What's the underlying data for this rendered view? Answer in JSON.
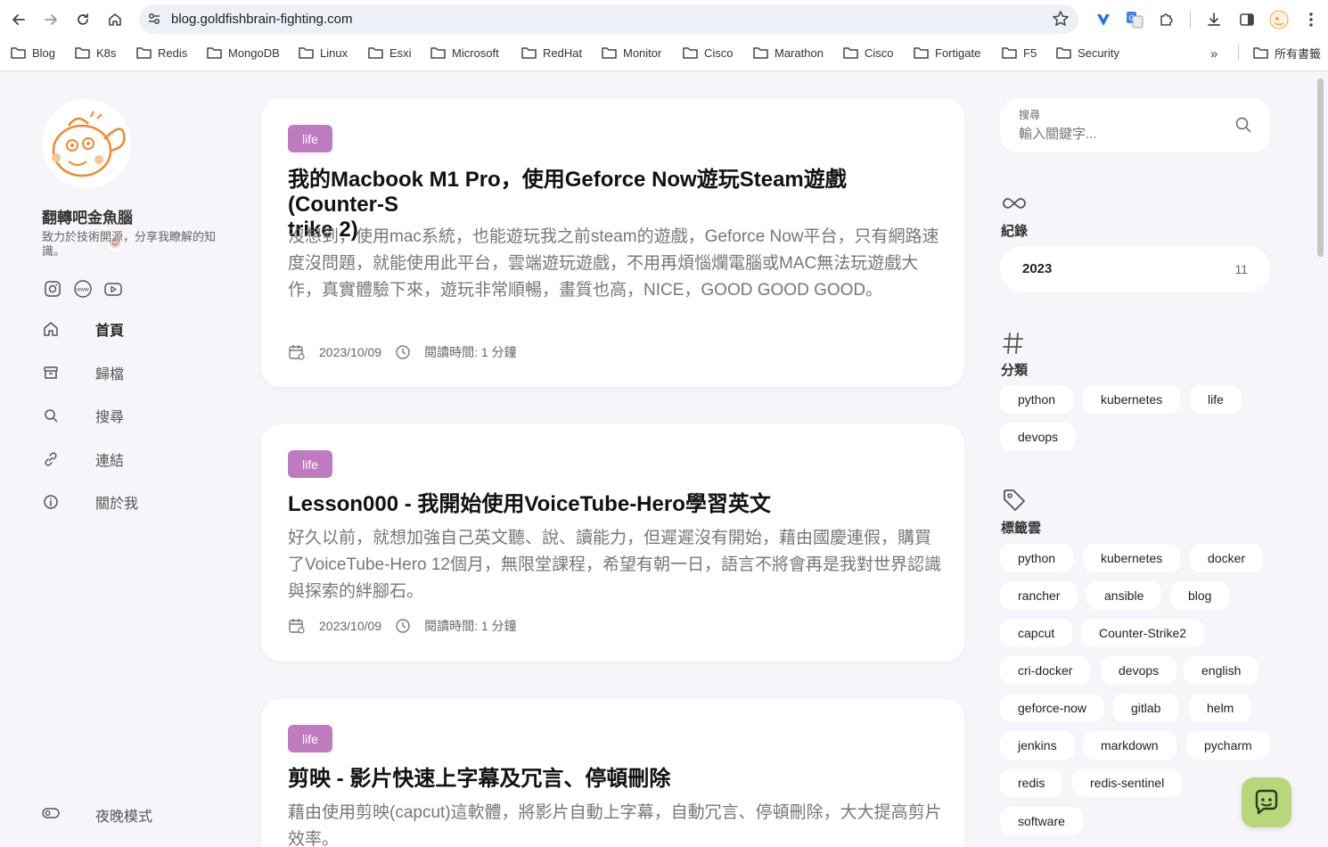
{
  "browser": {
    "url": "blog.goldfishbrain-fighting.com",
    "bookmarks": [
      "Blog",
      "K8s",
      "Redis",
      "MongoDB",
      "Linux",
      "Esxi",
      "Microsoft",
      "RedHat",
      "Monitor",
      "Cisco",
      "Marathon",
      "Cisco",
      "Fortigate",
      "F5",
      "Security"
    ],
    "all_bookmarks": "所有書籤",
    "more": "»"
  },
  "sidebar": {
    "site_title": "翻轉吧金魚腦",
    "site_desc": "致力於技術開源，分享我瞭解的知識。",
    "menu": [
      {
        "label": "首頁",
        "icon": "home-icon"
      },
      {
        "label": "歸檔",
        "icon": "archive-icon"
      },
      {
        "label": "搜尋",
        "icon": "search-icon"
      },
      {
        "label": "連結",
        "icon": "link-icon"
      },
      {
        "label": "關於我",
        "icon": "info-icon"
      }
    ],
    "night_mode": "夜晚模式"
  },
  "posts": [
    {
      "category": "life",
      "title": "我的Macbook M1 Pro，使用Geforce Now遊玩Steam遊戲(Counter-Strike 2)",
      "title_line1": "我的Macbook M1 Pro，使用Geforce Now遊玩Steam遊戲(Counter-S",
      "title_line2": "trike 2)",
      "excerpt": "沒想到，使用mac系統，也能遊玩我之前steam的遊戲，Geforce Now平台，只有網路速度沒問題，就能使用此平台，雲端遊玩遊戲，不用再煩惱爛電腦或MAC無法玩遊戲大作，真實體驗下來，遊玩非常順暢，畫質也高，NICE，GOOD GOOD GOOD。",
      "date": "2023/10/09",
      "read_time": "閱讀時間: 1 分鐘"
    },
    {
      "category": "life",
      "title": "Lesson000 - 我開始使用VoiceTube-Hero學習英文",
      "excerpt": "好久以前，就想加強自己英文聽、說、讀能力，但遲遲沒有開始，藉由國慶連假，購買了VoiceTube-Hero 12個月，無限堂課程，希望有朝一日，語言不將會再是我對世界認識與探索的絆腳石。",
      "date": "2023/10/09",
      "read_time": "閱讀時間: 1 分鐘"
    },
    {
      "category": "life",
      "title": "剪映 - 影片快速上字幕及冗言、停頓刪除",
      "excerpt": "藉由使用剪映(capcut)這軟體，將影片自動上字幕，自動冗言、停頓刪除，大大提高剪片效率。"
    }
  ],
  "search": {
    "label": "搜尋",
    "placeholder": "輸入關鍵字..."
  },
  "widgets": {
    "archive_title": "紀錄",
    "archive": {
      "year": "2023",
      "count": "11"
    },
    "categories_title": "分類",
    "categories": [
      "python",
      "kubernetes",
      "life",
      "devops"
    ],
    "tags_title": "標籤雲",
    "tags": [
      "python",
      "kubernetes",
      "docker",
      "rancher",
      "ansible",
      "blog",
      "capcut",
      "Counter-Strike2",
      "cri-docker",
      "devops",
      "english",
      "geforce-now",
      "gitlab",
      "helm",
      "jenkins",
      "markdown",
      "pycharm",
      "redis",
      "redis-sentinel",
      "software"
    ]
  },
  "colors": {
    "category_pill": "#c07bc0",
    "page_bg": "#f5f5fa",
    "chat_button": "#b7d77a"
  }
}
